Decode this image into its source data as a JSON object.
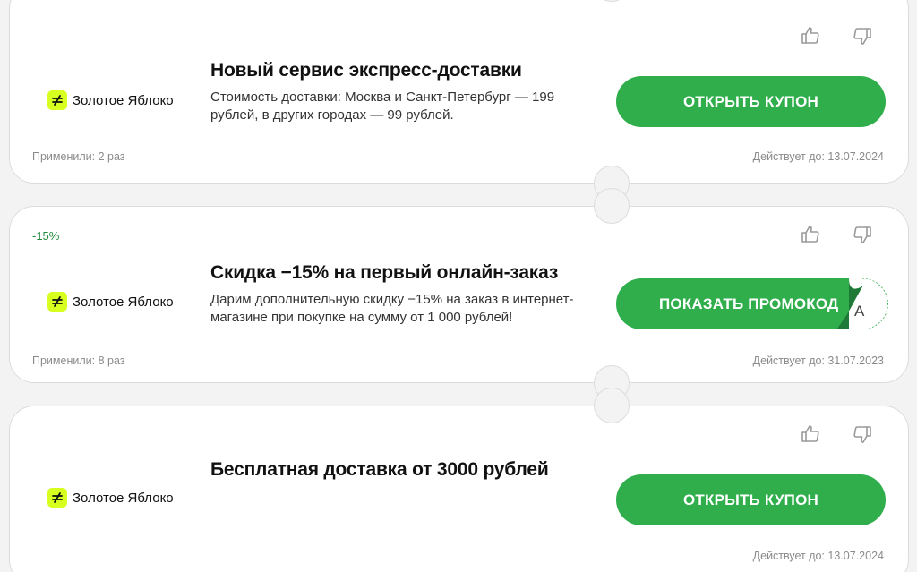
{
  "coupons": [
    {
      "discount": "",
      "brand": "Золотое Яблоко",
      "title": "Новый сервис экспресс-доставки",
      "description": "Стоимость доставки: Москва и Санкт-Петербург — 199 рублей, в других городах — 99 рублей.",
      "button_label": "ОТКРЫТЬ КУПОН",
      "used": "Применили: 2 раз",
      "valid": "Действует до: 13.07.2024"
    },
    {
      "discount": "-15%",
      "brand": "Золотое Яблоко",
      "title": "Скидка −15% на первый онлайн-заказ",
      "description": "Дарим дополнительную скидку −15% на заказ в интернет-магазине при покупке на сумму от 1 000 рублей!",
      "button_label": "ПОКАЗАТЬ ПРОМОКОД",
      "peek_char": "A",
      "used": "Применили: 8 раз",
      "valid": "Действует до: 31.07.2023"
    },
    {
      "discount": "",
      "brand": "Золотое Яблоко",
      "title": "Бесплатная доставка от 3000 рублей",
      "description": "",
      "button_label": "ОТКРЫТЬ КУПОН",
      "used": "",
      "valid": "Действует до: 13.07.2024"
    }
  ],
  "icons": {
    "like": "thumbs-up-icon",
    "dislike": "thumbs-down-icon",
    "brand": "golden-apple-logo"
  },
  "colors": {
    "button": "#2fae4b",
    "discount": "#1c8a3a",
    "brand_mark": "#d7ff1f",
    "background": "#f3f3f3"
  }
}
